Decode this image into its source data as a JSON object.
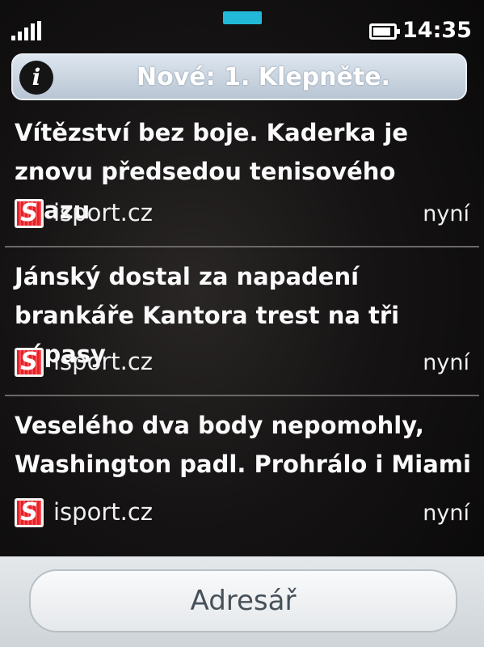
{
  "status_bar": {
    "signal_icon": "signal-bars-icon",
    "battery_icon": "battery-icon",
    "battery_level": 0.9,
    "time": "14:35",
    "accent_color": "#22b8d8"
  },
  "notice": {
    "icon": "info-icon",
    "icon_glyph": "i",
    "text": "Nové: 1. Klepněte."
  },
  "feed": {
    "items": [
      {
        "headline": "Vítězství bez boje. Kaderka je znovu předsedou tenisového svazu",
        "logo_glyph": "S",
        "source": "isport.cz",
        "time": "nyní"
      },
      {
        "headline": "Jánský dostal za napadení brankáře Kantora trest na tři zápasy",
        "logo_glyph": "S",
        "source": "isport.cz",
        "time": "nyní"
      },
      {
        "headline": "Veselého dva body nepomohly, Washington padl. Prohrálo i Miami",
        "logo_glyph": "S",
        "source": "isport.cz",
        "time": "nyní"
      }
    ]
  },
  "bottom": {
    "contacts_label": "Adresář"
  }
}
